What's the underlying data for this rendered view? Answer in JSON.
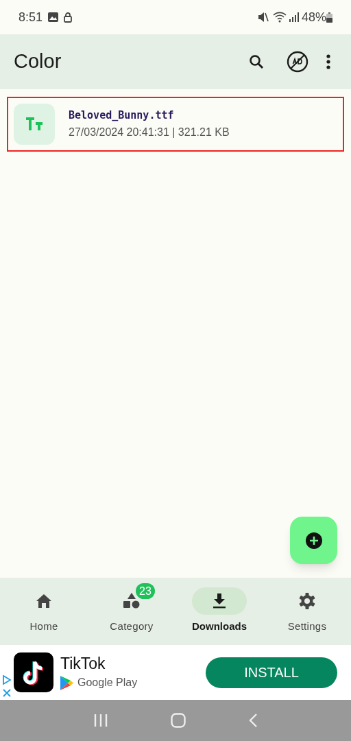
{
  "status_bar": {
    "time": "8:51",
    "battery": "48%"
  },
  "app_bar": {
    "title": "Color"
  },
  "files": [
    {
      "name": "Beloved_Bunny.ttf",
      "details": "27/03/2024 20:41:31 | 321.21 KB",
      "highlighted": true
    }
  ],
  "bottom_nav": [
    {
      "label": "Home",
      "kind": "home",
      "selected": false
    },
    {
      "label": "Category",
      "kind": "category",
      "selected": false,
      "badge": "23"
    },
    {
      "label": "Downloads",
      "kind": "downloads",
      "selected": true
    },
    {
      "label": "Settings",
      "kind": "settings",
      "selected": false
    }
  ],
  "ad": {
    "title": "TikTok",
    "store": "Google Play",
    "button": "INSTALL"
  }
}
